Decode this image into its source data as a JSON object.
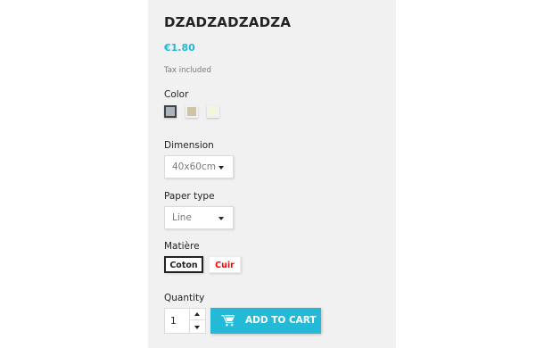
{
  "product": {
    "name": "DZADZADZADZA",
    "price": "€1.80",
    "tax_note": "Tax included"
  },
  "color": {
    "label": "Color",
    "swatches": [
      {
        "name": "grey",
        "hex": "#aab2bd",
        "selected": true
      },
      {
        "name": "taupe",
        "hex": "#cfc4a6",
        "selected": false
      },
      {
        "name": "offwhite",
        "hex": "#f5f5dc",
        "selected": false
      }
    ]
  },
  "dimension": {
    "label": "Dimension",
    "value": "40x60cm"
  },
  "paper_type": {
    "label": "Paper type",
    "value": "Line"
  },
  "material": {
    "label": "Matière",
    "options": [
      {
        "label": "Coton",
        "selected": true,
        "color": "#232323"
      },
      {
        "label": "Cuir",
        "selected": false,
        "color": "#ff0000"
      }
    ]
  },
  "quantity": {
    "label": "Quantity",
    "value": "1"
  },
  "add_to_cart": {
    "label": "ADD TO CART",
    "icon": "shopping-cart-icon"
  },
  "colors": {
    "accent": "#24b9d7",
    "panel_bg": "#f1f1f1",
    "text": "#232323"
  }
}
